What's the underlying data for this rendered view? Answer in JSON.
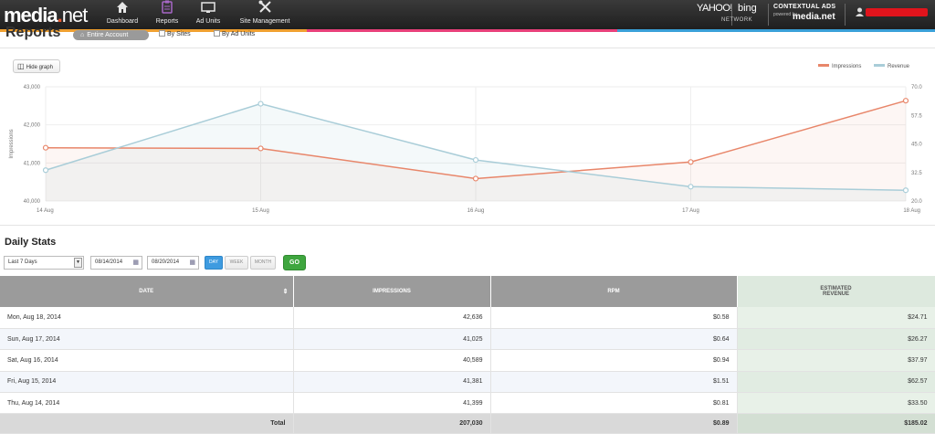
{
  "header": {
    "logo_main": "media",
    "logo_dot": ".",
    "logo_net": "net",
    "nav": [
      {
        "label": "Dashboard",
        "icon": "home-icon"
      },
      {
        "label": "Reports",
        "icon": "clipboard-icon"
      },
      {
        "label": "Ad Units",
        "icon": "monitor-icon"
      },
      {
        "label": "Site Management",
        "icon": "tools-icon"
      }
    ],
    "partner_yahoo": "YAHOO!",
    "partner_bing": "bing",
    "partner_network": "NETWORK",
    "contextual_title": "CONTEXTUAL ADS",
    "contextual_powered": "powered by",
    "contextual_brand": "media.net"
  },
  "reports": {
    "title": "Reports",
    "tab_active": "Entire Account",
    "opt_sites": "By Sites",
    "opt_adunits": "By Ad Units"
  },
  "graph": {
    "hide_label": "Hide graph",
    "legend_impressions": "Impressions",
    "legend_revenue": "Revenue",
    "color_impressions": "#e8866a",
    "color_revenue": "#a9cdd8"
  },
  "chart_data": {
    "type": "line",
    "categories": [
      "14 Aug",
      "15 Aug",
      "16 Aug",
      "17 Aug",
      "18 Aug"
    ],
    "series": [
      {
        "name": "Impressions",
        "axis": "left",
        "values": [
          41399,
          41381,
          40589,
          41025,
          42636
        ]
      },
      {
        "name": "Revenue",
        "axis": "right",
        "values": [
          33.5,
          62.57,
          37.97,
          26.27,
          24.71
        ]
      }
    ],
    "y_left": {
      "min": 40000,
      "max": 43000,
      "ticks": [
        "40,000",
        "41,000",
        "42,000",
        "43,000"
      ],
      "label": "Impressions"
    },
    "y_right": {
      "min": 20,
      "max": 70,
      "ticks": [
        "20.0",
        "32.5",
        "45.0",
        "57.5",
        "70.0"
      ]
    },
    "legend": "top-right",
    "grid": true
  },
  "daily": {
    "title": "Daily Stats",
    "range": "Last 7 Days",
    "date_from": "08/14/2014",
    "date_to": "08/20/2014",
    "seg_day": "DAY",
    "seg_week": "WEEK",
    "seg_month": "MONTH",
    "go": "GO"
  },
  "table": {
    "headers": {
      "date": "DATE",
      "impressions": "IMPRESSIONS",
      "rpm": "RPM",
      "revenue_1": "ESTIMATED",
      "revenue_2": "REVENUE"
    },
    "rows": [
      {
        "date": "Mon, Aug 18, 2014",
        "impressions": "42,636",
        "rpm": "$0.58",
        "revenue": "$24.71"
      },
      {
        "date": "Sun, Aug 17, 2014",
        "impressions": "41,025",
        "rpm": "$0.64",
        "revenue": "$26.27"
      },
      {
        "date": "Sat, Aug 16, 2014",
        "impressions": "40,589",
        "rpm": "$0.94",
        "revenue": "$37.97"
      },
      {
        "date": "Fri, Aug 15, 2014",
        "impressions": "41,381",
        "rpm": "$1.51",
        "revenue": "$62.57"
      },
      {
        "date": "Thu, Aug 14, 2014",
        "impressions": "41,399",
        "rpm": "$0.81",
        "revenue": "$33.50"
      }
    ],
    "total": {
      "label": "Total",
      "impressions": "207,030",
      "rpm": "$0.89",
      "revenue": "$185.02"
    }
  }
}
